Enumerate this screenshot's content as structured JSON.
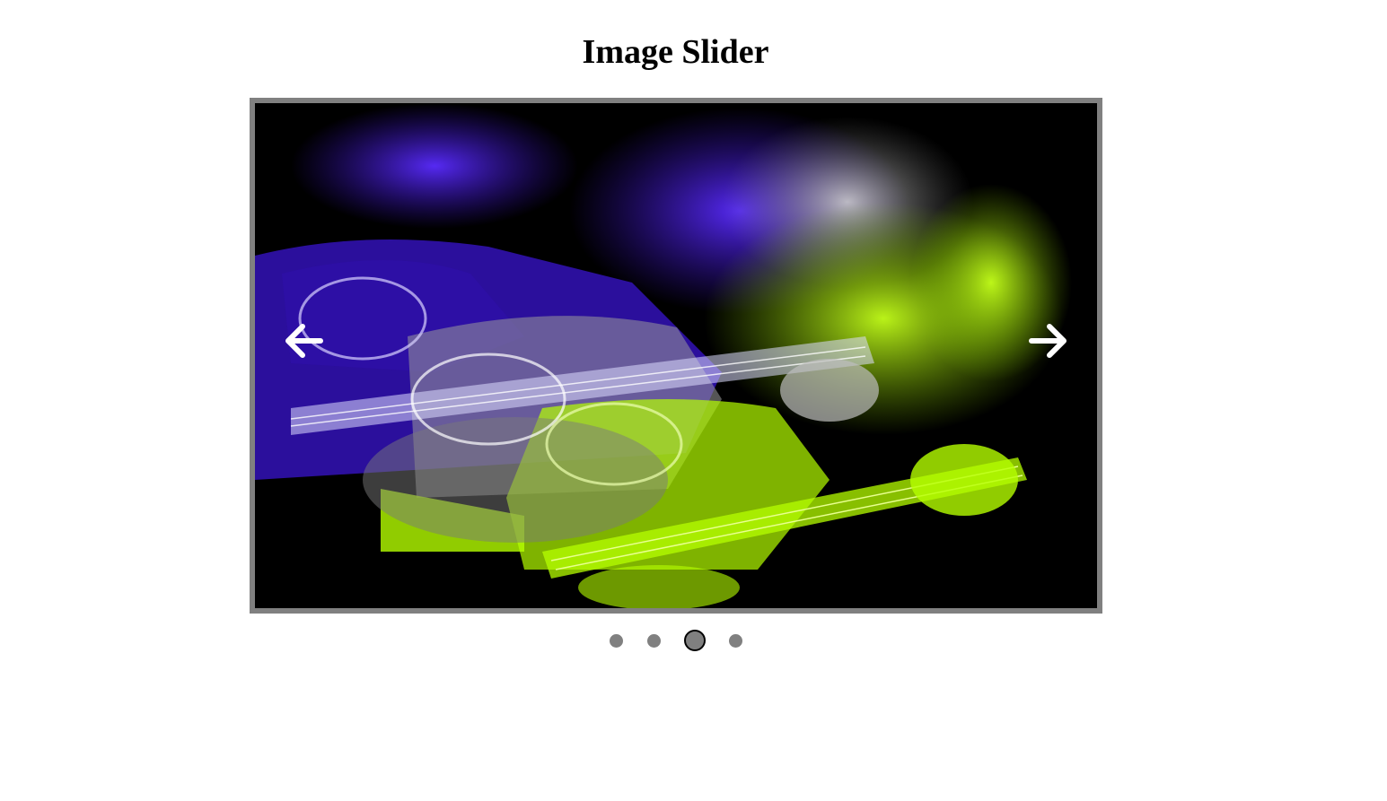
{
  "page": {
    "title": "Image Slider"
  },
  "slider": {
    "prev_icon": "arrow-left-icon",
    "next_icon": "arrow-right-icon",
    "slide_count": 4,
    "active_index": 3,
    "frame_color": "#808080",
    "arrow_color": "#ffffff"
  },
  "image_palette": {
    "background": "#000000",
    "purple": "#4a1ef0",
    "lime": "#b5ff00",
    "gray": "#b0b0b0"
  }
}
